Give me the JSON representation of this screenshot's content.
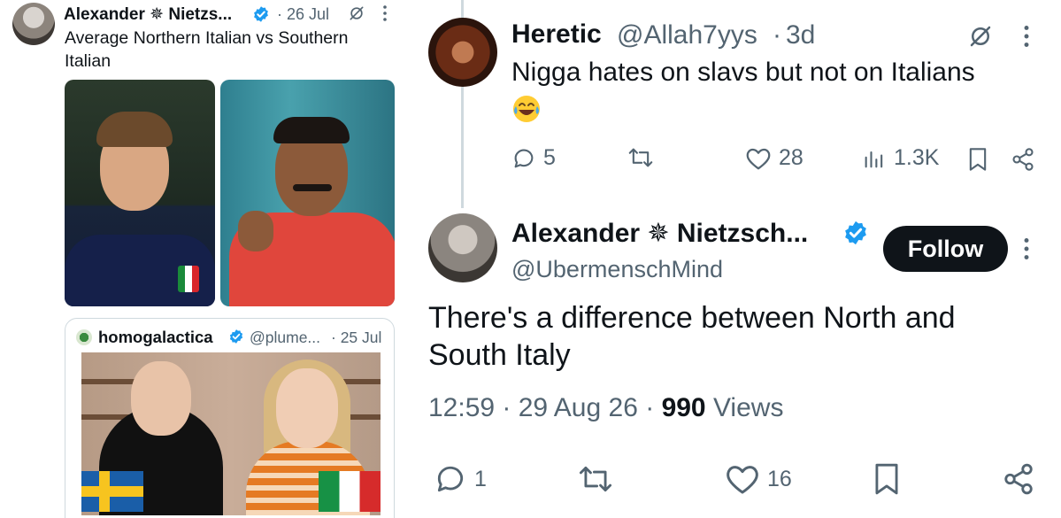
{
  "left_tweet": {
    "author_name": "Alexander ✵ Nietzs...",
    "date": "· 26 Jul",
    "text": "Average Northern Italian vs Southern Italian",
    "quoted": {
      "author_name": "homogalactica",
      "handle": "@plume...",
      "date": "· 25 Jul"
    }
  },
  "reply_tweet": {
    "author_name": "Heretic",
    "handle": "@Allah7yys",
    "dot": "·",
    "date": "3d",
    "text": "Nigga hates on slavs but not on Italians",
    "emoji": "face-with-tears-of-joy",
    "actions": {
      "replies": "5",
      "likes": "28",
      "views": "1.3K"
    }
  },
  "main_tweet": {
    "author_name": "Alexander ✵ Nietzsch...",
    "handle": "@UbermenschMind",
    "follow_label": "Follow",
    "text": "There's a difference between North and South Italy",
    "time": "12:59",
    "date": "29 Aug 26",
    "views_count": "990",
    "views_label": "Views",
    "actions": {
      "replies": "1",
      "likes": "16"
    }
  },
  "colors": {
    "text_primary": "#0f1419",
    "text_secondary": "#536471",
    "verified_blue": "#1d9bf0",
    "border": "#cfd9de"
  }
}
